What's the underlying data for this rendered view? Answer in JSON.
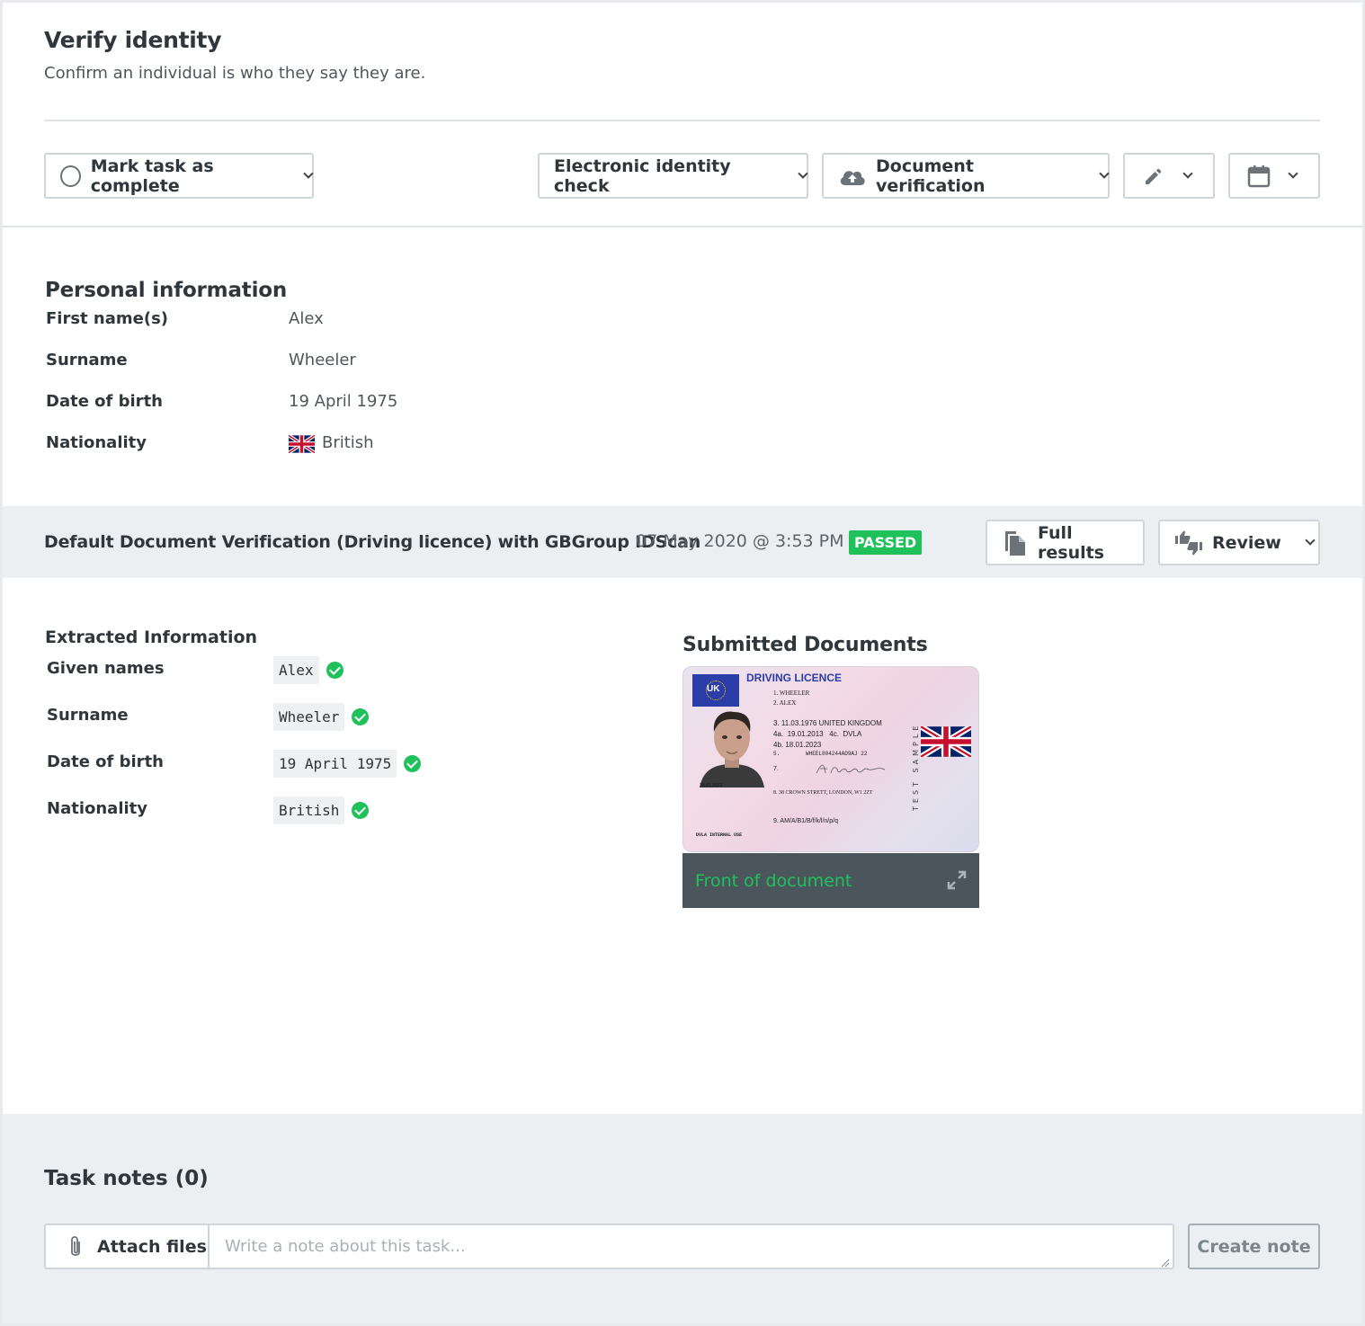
{
  "header": {
    "title": "Verify identity",
    "subtitle": "Confirm an individual is who they say they are."
  },
  "toolbar": {
    "mark_complete_label": "Mark task as complete",
    "electronic_check_label": "Electronic identity check",
    "document_verification_label": "Document verification",
    "edit_icon": "pencil-icon",
    "calendar_icon": "calendar-icon"
  },
  "personal": {
    "heading": "Personal information",
    "rows": [
      {
        "label": "First name(s)",
        "value": "Alex"
      },
      {
        "label": "Surname",
        "value": "Wheeler"
      },
      {
        "label": "Date of birth",
        "value": "19 April 1975"
      },
      {
        "label": "Nationality",
        "value": "British"
      }
    ]
  },
  "check": {
    "title": "Default Document Verification (Driving licence) with GBGroup IDScan",
    "date": "07 May 2020 @ 3:53 PM",
    "status": "PASSED",
    "status_color": "#1fc15a",
    "full_results_label": "Full results",
    "review_label": "Review"
  },
  "extracted": {
    "heading": "Extracted Information",
    "rows": [
      {
        "label": "Given names",
        "value": "Alex"
      },
      {
        "label": "Surname",
        "value": "Wheeler"
      },
      {
        "label": "Date of birth",
        "value": "19 April 1975"
      },
      {
        "label": "Nationality",
        "value": "British"
      }
    ]
  },
  "documents": {
    "heading": "Submitted Documents",
    "caption": "Front of document",
    "licence": {
      "title": "DRIVING LICENCE",
      "country": "UK",
      "line1": "1. WHEELER",
      "line2": "2. ALEX",
      "line3": "3.  11.03.1976  UNITED KINGDOM",
      "line4a": "4a.  19.01.2013   4c.  DVLA",
      "line4b": "4b.  18.01.2023",
      "line5": "5.        WHEEL804244AD9AJ 22",
      "line7": "7.",
      "line8": "8. 38 CROWN STRETT, LONDON, W1 2ZT",
      "line9": "9.   AM/A/B1/B/f/k/l/n/p/q",
      "footer": "DVLA INTERNAL USE",
      "photo_date": "18.01.2023",
      "side_text": "TEST SAMPLE"
    }
  },
  "notes": {
    "heading": "Task notes (0)",
    "attach_label": "Attach files",
    "placeholder": "Write a note about this task...",
    "create_label": "Create note"
  }
}
